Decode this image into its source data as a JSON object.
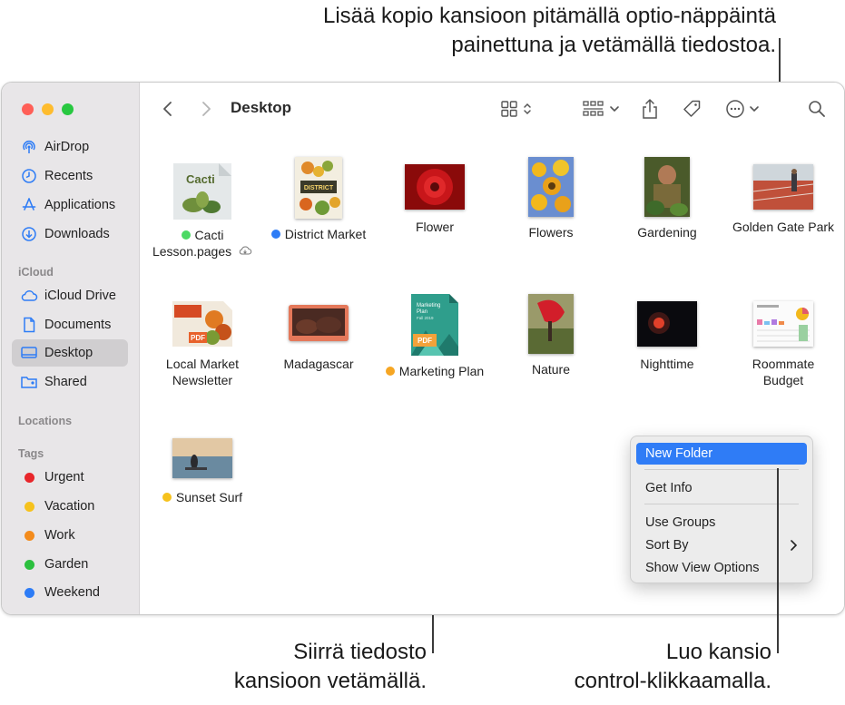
{
  "callouts": {
    "top_line1": "Lisää kopio kansioon pitämällä optio-näppäintä",
    "top_line2": "painettuna ja vetämällä tiedostoa.",
    "bottom_left_line1": "Siirrä tiedosto",
    "bottom_left_line2": "kansioon vetämällä.",
    "bottom_right_line1": "Luo kansio",
    "bottom_right_line2": "control-klikkaamalla."
  },
  "window": {
    "title": "Desktop"
  },
  "sidebar": {
    "items": [
      {
        "label": "AirDrop",
        "icon": "airdrop-icon"
      },
      {
        "label": "Recents",
        "icon": "clock-icon"
      },
      {
        "label": "Applications",
        "icon": "applications-icon"
      },
      {
        "label": "Downloads",
        "icon": "download-icon"
      }
    ],
    "icloud_header": "iCloud",
    "icloud_items": [
      {
        "label": "iCloud Drive",
        "icon": "cloud-icon"
      },
      {
        "label": "Documents",
        "icon": "document-icon"
      },
      {
        "label": "Desktop",
        "icon": "desktop-icon",
        "selected": true
      },
      {
        "label": "Shared",
        "icon": "shared-folder-icon"
      }
    ],
    "locations_header": "Locations",
    "tags_header": "Tags",
    "tags": [
      {
        "label": "Urgent",
        "color": "#e8262b"
      },
      {
        "label": "Vacation",
        "color": "#f6c21d"
      },
      {
        "label": "Work",
        "color": "#f38b1c"
      },
      {
        "label": "Garden",
        "color": "#2cc03f"
      },
      {
        "label": "Weekend",
        "color": "#2d7cf6"
      }
    ]
  },
  "files": [
    {
      "name": "Cacti Lesson.pages",
      "line1": "Cacti",
      "line2": "Lesson.pages",
      "tag_color": "#4cd964",
      "cloud": true
    },
    {
      "name": "District Market",
      "tag_color": "#2d7cf6"
    },
    {
      "name": "Flower"
    },
    {
      "name": "Flowers"
    },
    {
      "name": "Gardening"
    },
    {
      "name": "Golden Gate Park"
    },
    {
      "name": "Local Market Newsletter",
      "line1": "Local Market",
      "line2": "Newsletter"
    },
    {
      "name": "Madagascar"
    },
    {
      "name": "Marketing Plan",
      "tag_color": "#f6a623"
    },
    {
      "name": "Nature"
    },
    {
      "name": "Nighttime"
    },
    {
      "name": "Roommate Budget",
      "line1": "Roommate",
      "line2": "Budget"
    },
    {
      "name": "Sunset Surf",
      "tag_color": "#f6c21d"
    }
  ],
  "thumb_text": {
    "cacti": "Cacti",
    "district": "DISTRICT",
    "marketing_line1": "Marketing",
    "marketing_line2": "Plan",
    "marketing_line3": "Fall 2019",
    "pdf": "PDF"
  },
  "context_menu": {
    "new_folder": "New Folder",
    "get_info": "Get Info",
    "use_groups": "Use Groups",
    "sort_by": "Sort By",
    "show_view_options": "Show View Options"
  },
  "colors": {
    "accent": "#2f7cf6",
    "sidebar_bg": "#e8e6e8"
  }
}
